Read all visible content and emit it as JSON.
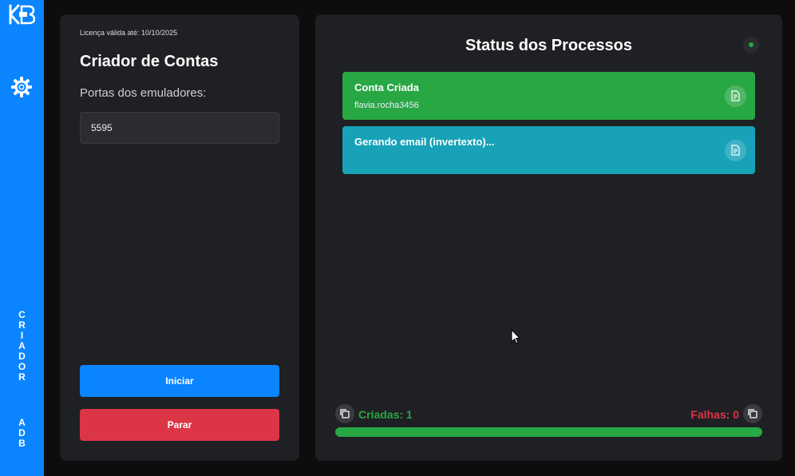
{
  "sidebar": {
    "logo_text": "KB",
    "vertical_word_1": [
      "C",
      "R",
      "I",
      "A",
      "D",
      "O",
      "R"
    ],
    "vertical_word_2": [
      "A",
      "D",
      "B"
    ],
    "accent": "#0a84ff"
  },
  "left": {
    "license": "Licença válida até: 10/10/2025",
    "title": "Criador de Contas",
    "ports_label": "Portas dos emuladores:",
    "ports_value": "5595",
    "start_label": "Iniciar",
    "stop_label": "Parar"
  },
  "right": {
    "title": "Status dos Processos",
    "cards": [
      {
        "title": "Conta Criada",
        "subtitle": "flavia.rocha3456",
        "color": "#28a745",
        "icon": "document-icon"
      },
      {
        "title": "Gerando email (invertexto)...",
        "subtitle": "",
        "color": "#17a2b8",
        "icon": "document-icon"
      }
    ],
    "created_label": "Criadas: 1",
    "failed_label": "Falhas: 0",
    "progress": 1.0
  }
}
